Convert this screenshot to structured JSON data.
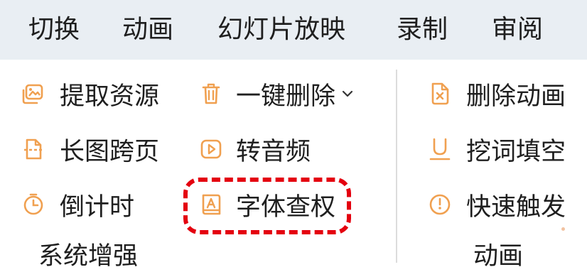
{
  "tabs": [
    "切换",
    "动画",
    "幻灯片放映",
    "录制",
    "审阅"
  ],
  "tools": {
    "extract_resources": {
      "label": "提取资源",
      "icon": "image-extract-icon"
    },
    "long_image_page": {
      "label": "长图跨页",
      "icon": "long-image-icon"
    },
    "countdown": {
      "label": "倒计时",
      "icon": "timer-icon"
    },
    "one_click_delete": {
      "label": "一键删除",
      "icon": "trash-icon",
      "dropdown": "chevron-down-icon"
    },
    "audio_to_video": {
      "label": "转音频",
      "icon": "play-icon"
    },
    "font_check": {
      "label": "字体查权",
      "icon": "font-book-icon"
    },
    "delete_animation": {
      "label": "删除动画",
      "icon": "file-x-icon"
    },
    "cloze_fill": {
      "label": "挖词填空",
      "icon": "underline-icon"
    },
    "quick_trigger_line1": "快速触发",
    "quick_trigger_line2": "动画",
    "quick_trigger_icon": "clock-icon"
  },
  "groups": {
    "system_enhance": "系统增强",
    "animation": "动画"
  },
  "colors": {
    "accent_orange": "#f0a050",
    "highlight_red": "#e4000f",
    "tab_bar_bg": "#e9eef3"
  }
}
